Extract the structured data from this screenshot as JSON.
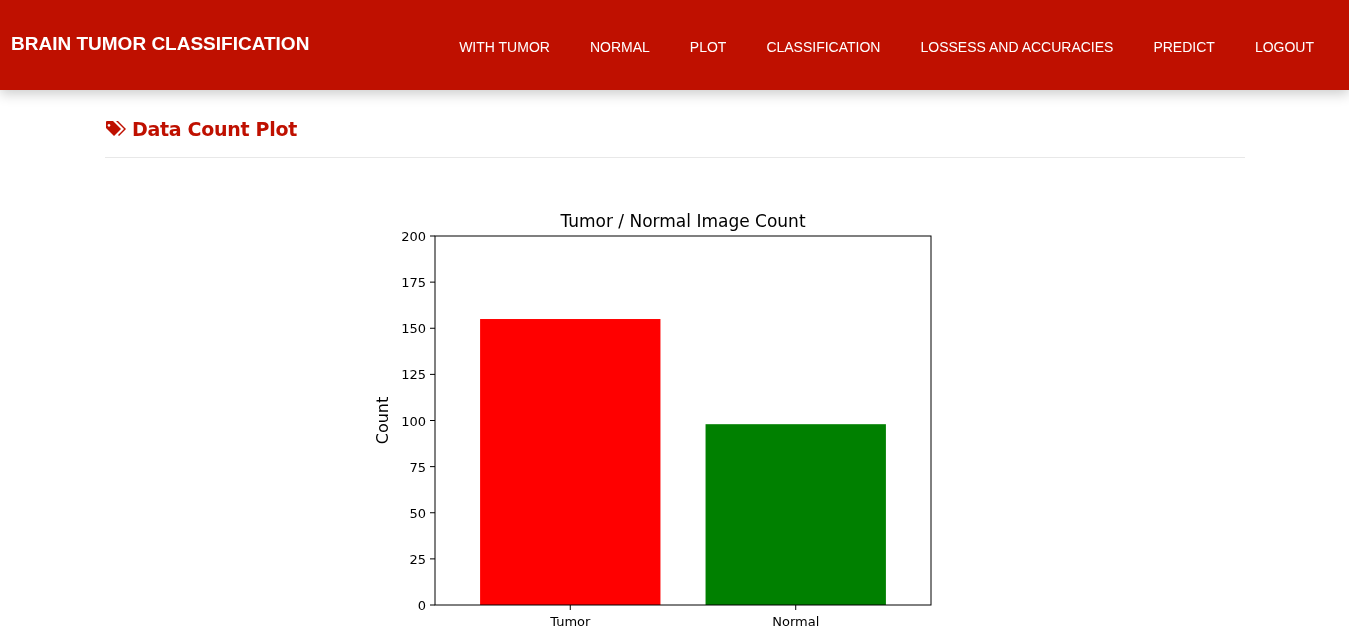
{
  "navbar": {
    "brand": "BRAIN TUMOR CLASSIFICATION",
    "links": [
      {
        "label": "WITH TUMOR"
      },
      {
        "label": "NORMAL"
      },
      {
        "label": "PLOT"
      },
      {
        "label": "CLASSIFICATION"
      },
      {
        "label": "LOSSESS AND ACCURACIES"
      },
      {
        "label": "PREDICT"
      },
      {
        "label": "LOGOUT"
      }
    ]
  },
  "section": {
    "heading": "Data Count Plot",
    "chart_data": {
      "type": "bar",
      "title": "Tumor / Normal Image Count",
      "ylabel": "Count",
      "categories": [
        "Tumor",
        "Normal"
      ],
      "series": [
        {
          "colors": [
            "#ff0000",
            "#008000"
          ],
          "values": [
            155,
            98
          ]
        }
      ],
      "ylim": [
        0,
        200
      ],
      "yticks": [
        0,
        25,
        50,
        75,
        100,
        125,
        150,
        175,
        200
      ]
    }
  }
}
